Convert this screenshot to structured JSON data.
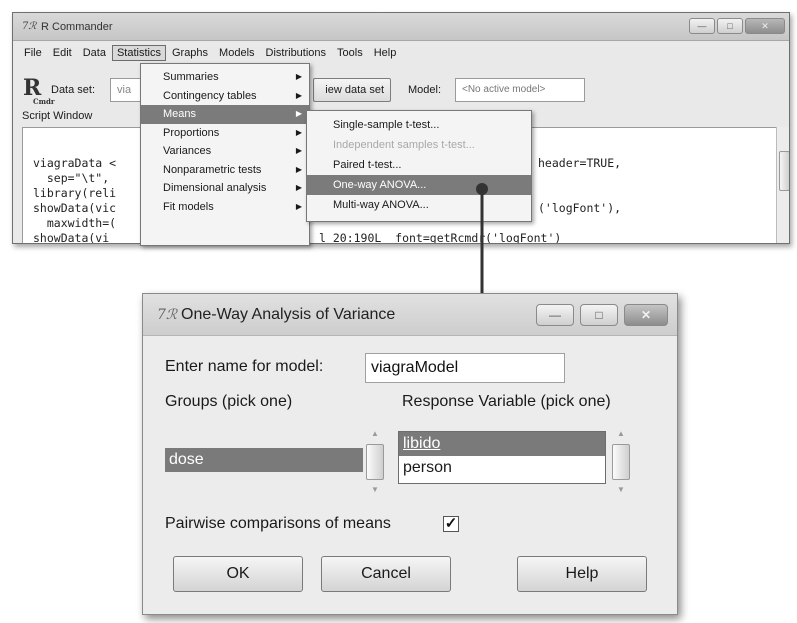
{
  "main_window": {
    "title": "R Commander",
    "logo_glyph": "7ℛ",
    "controls": {
      "minimize": "—",
      "maximize": "□",
      "close": "✕"
    },
    "menus": [
      "File",
      "Edit",
      "Data",
      "Statistics",
      "Graphs",
      "Models",
      "Distributions",
      "Tools",
      "Help"
    ],
    "active_menu": "Statistics",
    "toolbar": {
      "r_logo": "R",
      "r_logo_sub": "Cmdr",
      "dataset_label": "Data set:",
      "dataset_value": "via",
      "view_button": "iew data set",
      "model_label": "Model:",
      "model_value": "<No active model>"
    },
    "script_window_label": "Script Window",
    "script_lines": [
      "viagraData <",
      "  sep=\"\\t\",",
      "library(reli",
      "showData(vic",
      "  maxwidth=(",
      "showData(vi"
    ],
    "script_right": {
      "line1": "header=TRUE,",
      "line4": "('logFont'),",
      "line6": "l 20:190L  font=getRcmdr('logFont')"
    }
  },
  "statistics_menu": {
    "items": [
      {
        "label": "Summaries",
        "submenu": true
      },
      {
        "label": "Contingency tables",
        "submenu": true
      },
      {
        "label": "Means",
        "submenu": true,
        "highlighted": true
      },
      {
        "label": "Proportions",
        "submenu": true
      },
      {
        "label": "Variances",
        "submenu": true
      },
      {
        "label": "Nonparametric tests",
        "submenu": true
      },
      {
        "label": "Dimensional analysis",
        "submenu": true
      },
      {
        "label": "Fit models",
        "submenu": true
      }
    ]
  },
  "means_submenu": {
    "items": [
      {
        "label": "Single-sample t-test..."
      },
      {
        "label": "Independent samples t-test...",
        "disabled": true
      },
      {
        "label": "Paired t-test..."
      },
      {
        "label": "One-way ANOVA...",
        "highlighted": true
      },
      {
        "label": "Multi-way ANOVA..."
      }
    ]
  },
  "dialog": {
    "title": "One-Way Analysis of Variance",
    "logo_glyph": "7ℛ",
    "controls": {
      "minimize": "—",
      "maximize": "□",
      "close": "✕"
    },
    "model_name_label": "Enter name for model:",
    "model_name_value": "viagraModel",
    "groups_label": "Groups (pick one)",
    "groups_items": [
      "dose"
    ],
    "groups_selected": "dose",
    "response_label": "Response Variable (pick one)",
    "response_items": [
      "libido",
      "person"
    ],
    "response_selected": "libido",
    "pairwise_label": "Pairwise comparisons of means",
    "pairwise_checked": true,
    "check_glyph": "✓",
    "ok_label": "OK",
    "cancel_label": "Cancel",
    "help_label": "Help"
  },
  "icons": {
    "arrow_right": "▶",
    "scroll_up": "▲",
    "scroll_down": "▼"
  },
  "colors": {
    "highlight": "#7b7b7b",
    "connector": "#333333"
  }
}
